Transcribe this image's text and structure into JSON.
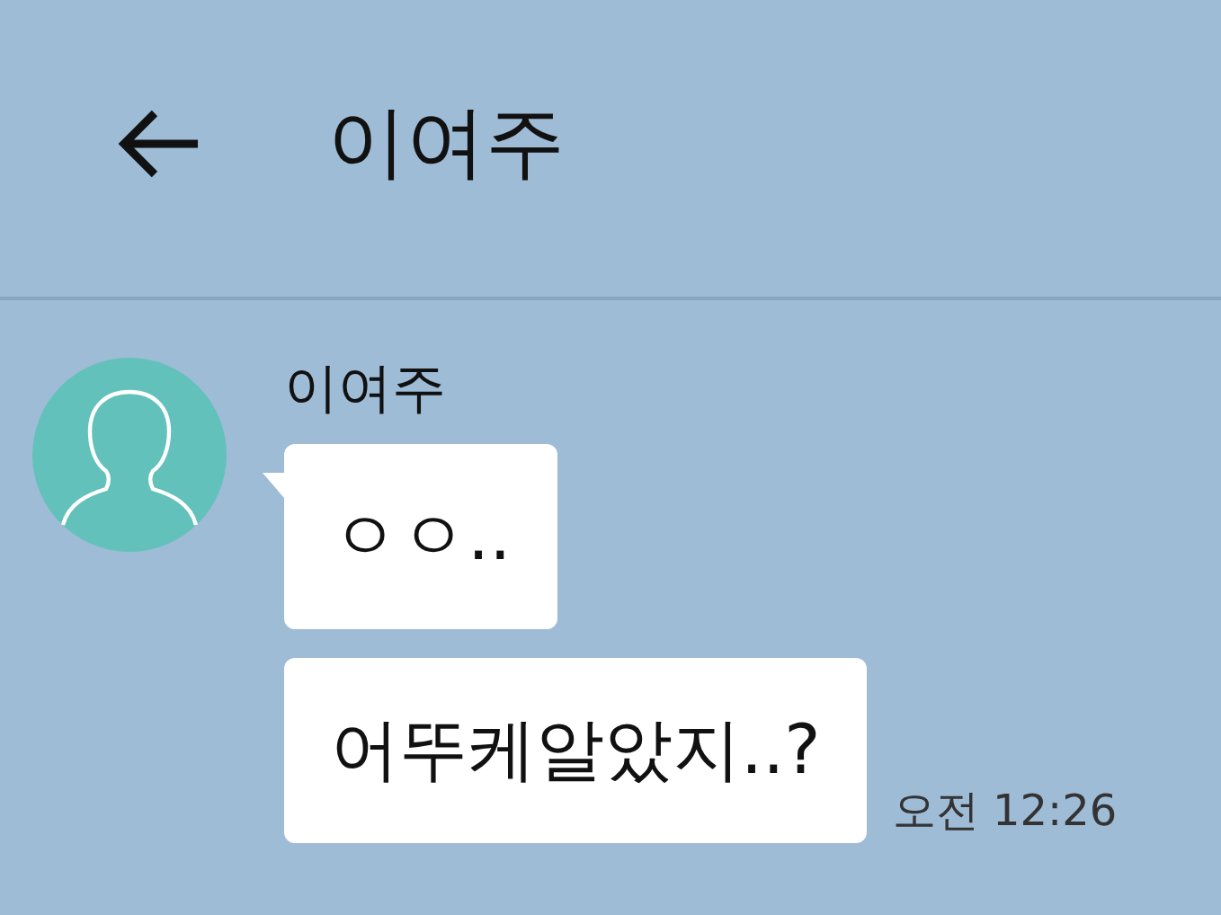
{
  "header": {
    "title": "이여주"
  },
  "chat": {
    "sender": "이여주",
    "messages": [
      {
        "text": "ㅇㅇ.."
      },
      {
        "text": "어뚜케알았지..?",
        "time": "오전 12:26"
      }
    ]
  }
}
